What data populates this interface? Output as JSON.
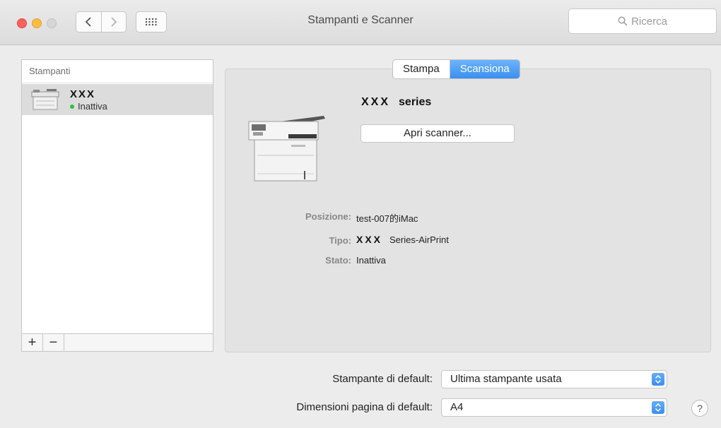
{
  "window": {
    "title": "Stampanti e Scanner"
  },
  "search": {
    "placeholder": "Ricerca"
  },
  "printers": {
    "header": "Stampanti",
    "items": [
      {
        "name": "XXX",
        "status": "Inattiva",
        "status_color": "#2cc23a"
      }
    ],
    "add_label": "+",
    "remove_label": "−"
  },
  "tabs": [
    {
      "label": "Stampa",
      "active": false
    },
    {
      "label": "Scansiona",
      "active": true
    }
  ],
  "device": {
    "name_mark": "XXX",
    "name_suffix": "series",
    "open_button": "Apri scanner..."
  },
  "info": {
    "position_label": "Posizione:",
    "position_value": "test-007的iMac",
    "type_label": "Tipo:",
    "type_mark": "XXX",
    "type_value": "Series-AirPrint",
    "state_label": "Stato:",
    "state_value": "Inattiva"
  },
  "defaults": {
    "printer_label": "Stampante di default:",
    "printer_value": "Ultima stampante usata",
    "paper_label": "Dimensioni pagina di default:",
    "paper_value": "A4"
  },
  "help": {
    "label": "?"
  },
  "colors": {
    "accent": "#3b8ff0",
    "close": "#fc605c",
    "minimize": "#fdbc40"
  }
}
